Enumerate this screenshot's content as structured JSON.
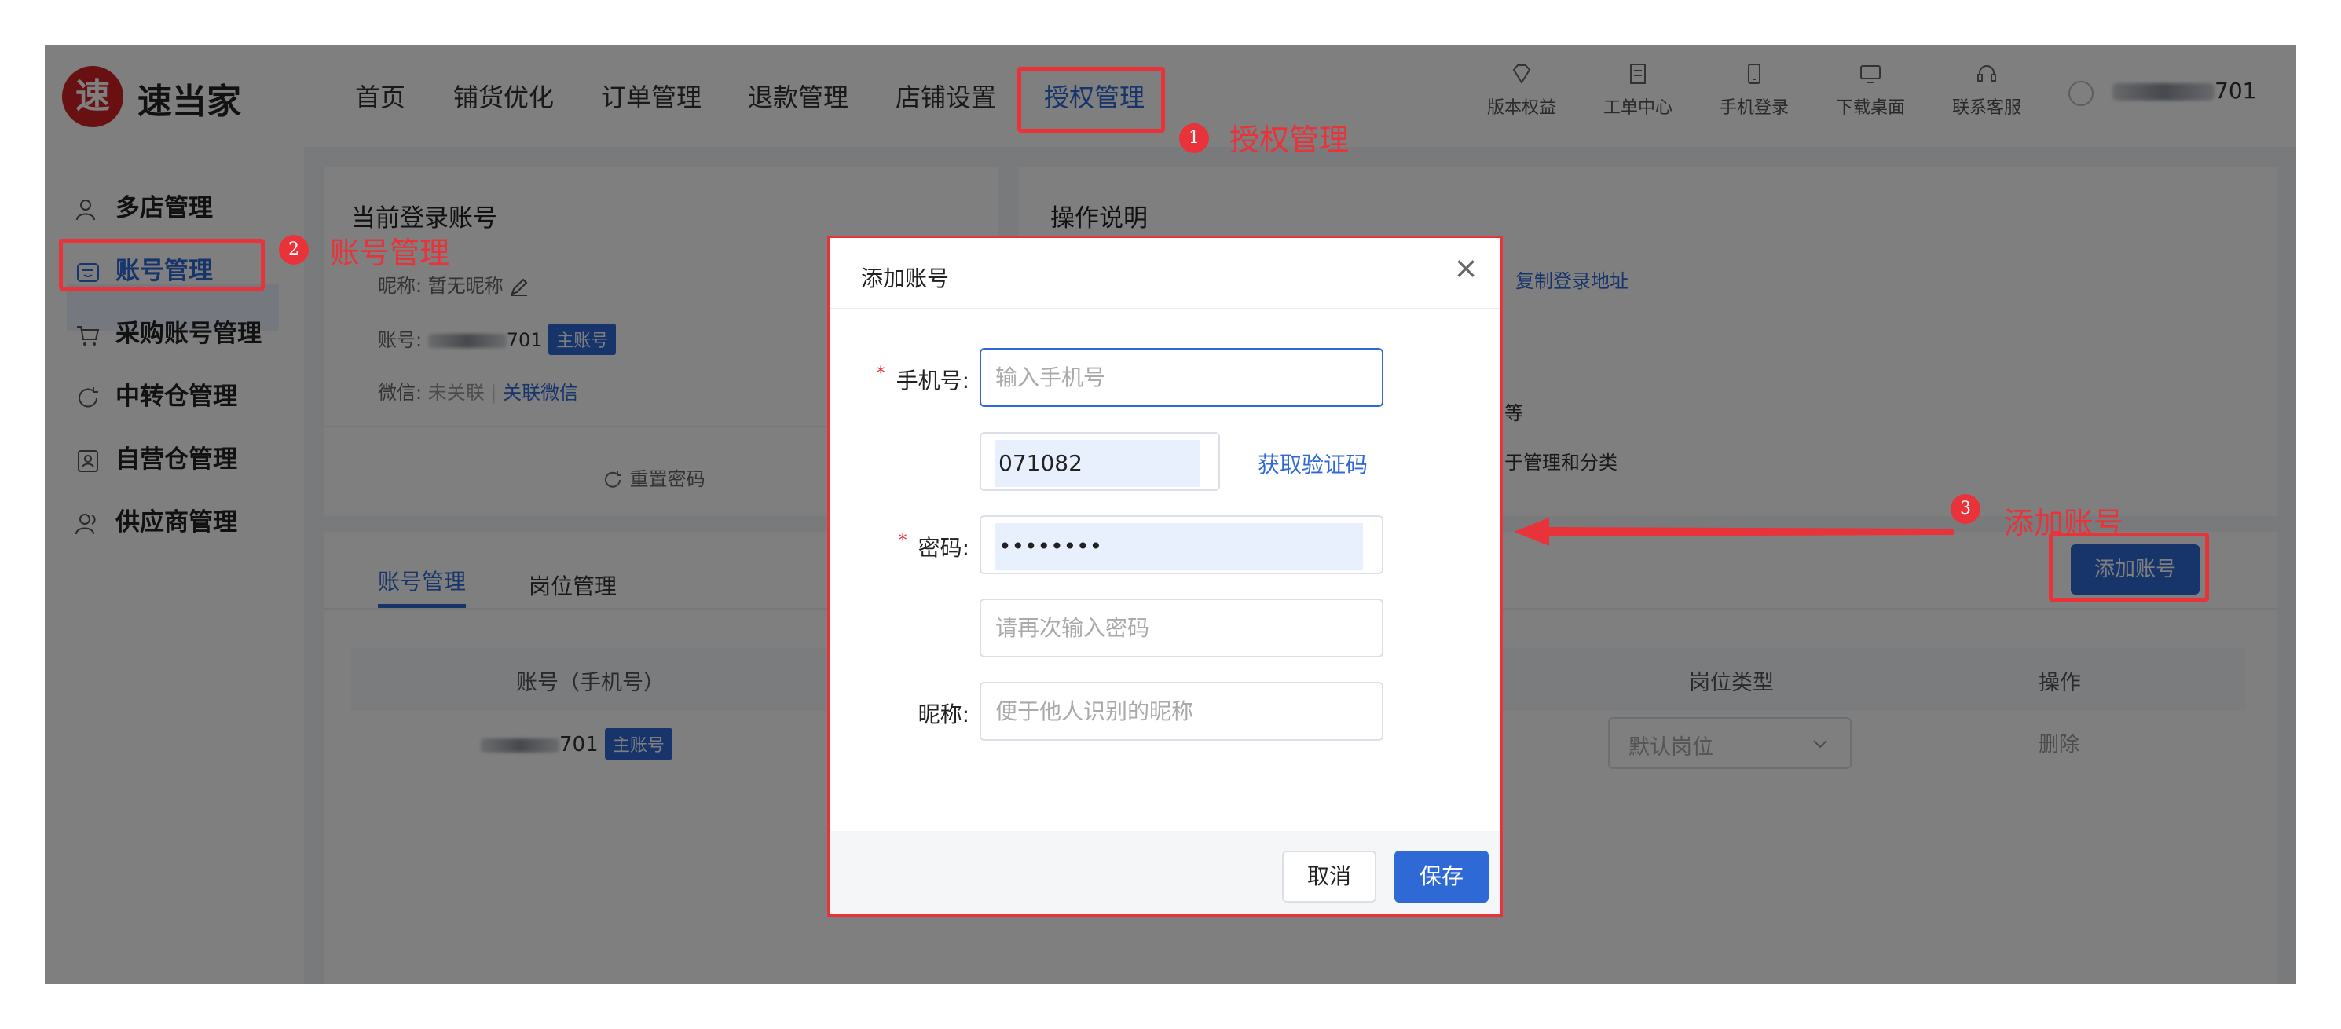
{
  "header": {
    "logo_char": "速",
    "logo_name": "速当家",
    "nav": [
      "首页",
      "铺货优化",
      "订单管理",
      "退款管理",
      "店铺设置",
      "授权管理"
    ],
    "tools": [
      {
        "label": "版本权益",
        "icon": "diamond-icon"
      },
      {
        "label": "工单中心",
        "icon": "clipboard-icon"
      },
      {
        "label": "手机登录",
        "icon": "phone-icon"
      },
      {
        "label": "下载桌面",
        "icon": "monitor-icon"
      },
      {
        "label": "联系客服",
        "icon": "headset-icon"
      }
    ],
    "user_suffix": "701"
  },
  "sidebar": {
    "items": [
      {
        "label": "多店管理",
        "icon": "users-icon"
      },
      {
        "label": "账号管理",
        "icon": "account-icon"
      },
      {
        "label": "采购账号管理",
        "icon": "cart-icon"
      },
      {
        "label": "中转仓管理",
        "icon": "refresh-icon"
      },
      {
        "label": "自营仓管理",
        "icon": "id-card-icon"
      },
      {
        "label": "供应商管理",
        "icon": "supplier-icon"
      }
    ]
  },
  "account_panel": {
    "title": "当前登录账号",
    "nickname_label": "昵称:",
    "nickname_value": "暂无昵称",
    "account_label": "账号:",
    "account_suffix": "701",
    "main_tag": "主账号",
    "wechat_label": "微信:",
    "wechat_value": "未关联",
    "wechat_link": "关联微信",
    "reset_password": "重置密码"
  },
  "ops_panel": {
    "title": "操作说明",
    "copy_link": "复制登录地址",
    "line_1": "等",
    "line_2": "于管理和分类"
  },
  "tabs": {
    "account": "账号管理",
    "role": "岗位管理"
  },
  "add_account_button": "添加账号",
  "table": {
    "headers": [
      "账号（手机号）",
      "岗位类型",
      "操作"
    ],
    "row": {
      "account_suffix": "701",
      "tag": "主账号",
      "role": "默认岗位",
      "action": "删除"
    }
  },
  "modal": {
    "title": "添加账号",
    "phone_label": "手机号:",
    "phone_placeholder": "输入手机号",
    "code_value": "071082",
    "get_code": "获取验证码",
    "password_label": "密码:",
    "password_value": "••••••••",
    "confirm_placeholder": "请再次输入密码",
    "nickname_label": "昵称:",
    "nickname_placeholder": "便于他人识别的昵称",
    "cancel": "取消",
    "save": "保存"
  },
  "annotations": [
    {
      "num": "1",
      "text": "授权管理"
    },
    {
      "num": "2",
      "text": "账号管理"
    },
    {
      "num": "3",
      "text": "添加账号"
    }
  ],
  "colors": {
    "accent": "#2f69d6",
    "annotation": "#e8333a",
    "logo": "#d32027"
  }
}
